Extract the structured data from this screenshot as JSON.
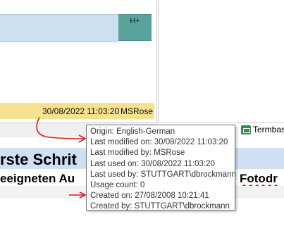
{
  "segment": {
    "badge": "H+",
    "status_date": "30/08/2022 11:03:20",
    "status_user": "MSRose"
  },
  "tab": {
    "termbase_label": "Termbas",
    "icon": "termbase-icon"
  },
  "document": {
    "line1": "rste Schrit",
    "line1_right": "",
    "line2": "eeigneten Au",
    "line2_right": "Fotodr"
  },
  "tooltip": {
    "lines": [
      "Origin: English-German",
      "Last modified on: 30/08/2022 11:03:20",
      "Last modified by: MSRose",
      "Last used on: 30/08/2022 11:03:20",
      "Last used by: STUTTGART\\dbrockmann",
      "Usage count: 0",
      "Created on: 27/08/2008 10:21:41",
      "Created by: STUTTGART\\dbrockmann"
    ]
  },
  "colors": {
    "segment_blue": "#cde0f2",
    "hplus_teal": "#5aa39c",
    "status_yellow": "#f6e18e",
    "annotation_red": "#e11a1a"
  }
}
